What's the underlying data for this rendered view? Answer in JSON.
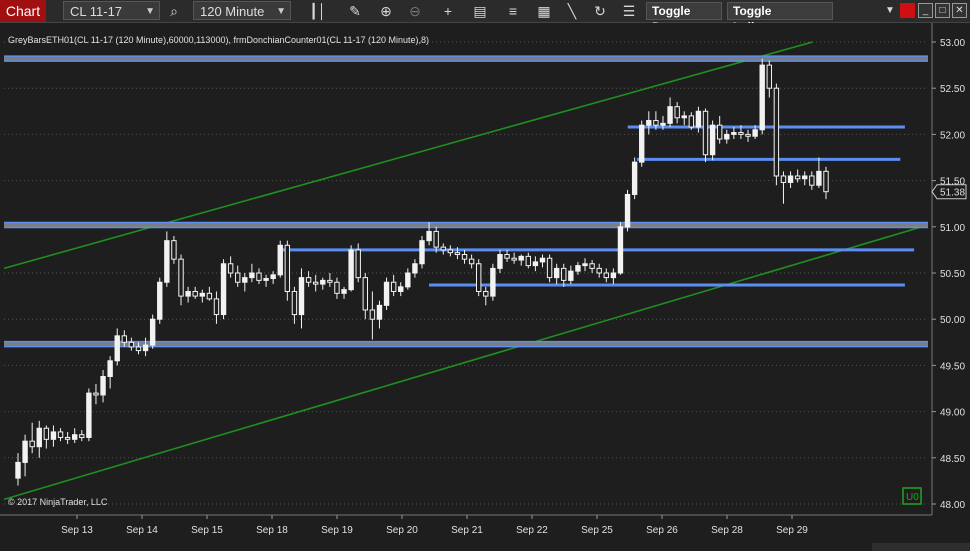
{
  "toolbar": {
    "chart_tab": "Chart",
    "instrument": "CL 11-17",
    "interval": "120 Minute",
    "toggle_draw": "Toggle Draw",
    "toggle_indicators": "Toggle Indicators",
    "icons": [
      "bars-style-icon",
      "pencil-icon",
      "zoom-in-icon",
      "zoom-out-icon",
      "crosshair-icon",
      "data-box-icon",
      "properties-icon",
      "strategies-icon",
      "drawing-tools-icon",
      "reload-icon",
      "list-icon"
    ]
  },
  "chart": {
    "header": "GreyBarsETH01(CL 11-17 (120 Minute),60000,113000), frmDonchianCounter01(CL 11-17 (120 Minute),8)",
    "copyright": "© 2017 NinjaTrader, LLC",
    "last_price": "51.38",
    "badge": "U0",
    "colors": {
      "background": "#1e1e1e",
      "candle": "#f2f2f2",
      "level": "#5b8ef0",
      "trend": "#1f8f1f",
      "badge": "#1fa51f"
    }
  },
  "chart_data": {
    "type": "candlestick",
    "ylim": [
      48.0,
      53.0
    ],
    "y_ticks": [
      "53.00",
      "52.50",
      "52.00",
      "51.50",
      "51.00",
      "50.50",
      "50.00",
      "49.50",
      "49.00",
      "48.50",
      "48.00"
    ],
    "x_ticks": [
      "Sep 13",
      "Sep 14",
      "Sep 15",
      "Sep 18",
      "Sep 19",
      "Sep 20",
      "Sep 21",
      "Sep 22",
      "Sep 25",
      "Sep 26",
      "Sep 28",
      "Sep 29"
    ],
    "candles": [
      {
        "o": 48.28,
        "h": 48.55,
        "l": 48.2,
        "c": 48.45
      },
      {
        "o": 48.45,
        "h": 48.75,
        "l": 48.3,
        "c": 48.68
      },
      {
        "o": 48.68,
        "h": 48.88,
        "l": 48.55,
        "c": 48.62
      },
      {
        "o": 48.62,
        "h": 48.9,
        "l": 48.5,
        "c": 48.82
      },
      {
        "o": 48.82,
        "h": 48.85,
        "l": 48.6,
        "c": 48.7
      },
      {
        "o": 48.7,
        "h": 48.85,
        "l": 48.62,
        "c": 48.78
      },
      {
        "o": 48.78,
        "h": 48.82,
        "l": 48.68,
        "c": 48.72
      },
      {
        "o": 48.72,
        "h": 48.78,
        "l": 48.65,
        "c": 48.7
      },
      {
        "o": 48.7,
        "h": 48.82,
        "l": 48.66,
        "c": 48.75
      },
      {
        "o": 48.75,
        "h": 48.8,
        "l": 48.68,
        "c": 48.72
      },
      {
        "o": 48.72,
        "h": 49.25,
        "l": 48.68,
        "c": 49.2
      },
      {
        "o": 49.2,
        "h": 49.3,
        "l": 49.08,
        "c": 49.18
      },
      {
        "o": 49.18,
        "h": 49.45,
        "l": 49.1,
        "c": 49.38
      },
      {
        "o": 49.38,
        "h": 49.6,
        "l": 49.25,
        "c": 49.55
      },
      {
        "o": 49.55,
        "h": 49.9,
        "l": 49.5,
        "c": 49.82
      },
      {
        "o": 49.82,
        "h": 49.88,
        "l": 49.7,
        "c": 49.75
      },
      {
        "o": 49.75,
        "h": 49.8,
        "l": 49.66,
        "c": 49.7
      },
      {
        "o": 49.7,
        "h": 49.75,
        "l": 49.62,
        "c": 49.66
      },
      {
        "o": 49.66,
        "h": 49.8,
        "l": 49.6,
        "c": 49.72
      },
      {
        "o": 49.72,
        "h": 50.05,
        "l": 49.68,
        "c": 50.0
      },
      {
        "o": 50.0,
        "h": 50.45,
        "l": 49.95,
        "c": 50.4
      },
      {
        "o": 50.4,
        "h": 50.95,
        "l": 50.35,
        "c": 50.85
      },
      {
        "o": 50.85,
        "h": 50.9,
        "l": 50.6,
        "c": 50.65
      },
      {
        "o": 50.65,
        "h": 50.7,
        "l": 50.15,
        "c": 50.25
      },
      {
        "o": 50.25,
        "h": 50.35,
        "l": 50.18,
        "c": 50.3
      },
      {
        "o": 50.3,
        "h": 50.35,
        "l": 50.22,
        "c": 50.25
      },
      {
        "o": 50.25,
        "h": 50.32,
        "l": 50.18,
        "c": 50.28
      },
      {
        "o": 50.28,
        "h": 50.35,
        "l": 50.2,
        "c": 50.22
      },
      {
        "o": 50.22,
        "h": 50.3,
        "l": 49.95,
        "c": 50.05
      },
      {
        "o": 50.05,
        "h": 50.65,
        "l": 50.0,
        "c": 50.6
      },
      {
        "o": 50.6,
        "h": 50.68,
        "l": 50.45,
        "c": 50.5
      },
      {
        "o": 50.5,
        "h": 50.58,
        "l": 50.35,
        "c": 50.4
      },
      {
        "o": 50.4,
        "h": 50.5,
        "l": 50.3,
        "c": 50.45
      },
      {
        "o": 50.45,
        "h": 50.6,
        "l": 50.4,
        "c": 50.5
      },
      {
        "o": 50.5,
        "h": 50.55,
        "l": 50.38,
        "c": 50.42
      },
      {
        "o": 50.42,
        "h": 50.48,
        "l": 50.35,
        "c": 50.44
      },
      {
        "o": 50.44,
        "h": 50.52,
        "l": 50.38,
        "c": 50.48
      },
      {
        "o": 50.48,
        "h": 50.85,
        "l": 50.45,
        "c": 50.8
      },
      {
        "o": 50.8,
        "h": 50.85,
        "l": 50.2,
        "c": 50.3
      },
      {
        "o": 50.3,
        "h": 50.35,
        "l": 49.95,
        "c": 50.05
      },
      {
        "o": 50.05,
        "h": 50.55,
        "l": 49.9,
        "c": 50.45
      },
      {
        "o": 50.45,
        "h": 50.52,
        "l": 50.35,
        "c": 50.4
      },
      {
        "o": 50.4,
        "h": 50.48,
        "l": 50.3,
        "c": 50.38
      },
      {
        "o": 50.38,
        "h": 50.45,
        "l": 50.32,
        "c": 50.42
      },
      {
        "o": 50.42,
        "h": 50.5,
        "l": 50.35,
        "c": 50.4
      },
      {
        "o": 50.4,
        "h": 50.45,
        "l": 50.22,
        "c": 50.28
      },
      {
        "o": 50.28,
        "h": 50.35,
        "l": 50.22,
        "c": 50.32
      },
      {
        "o": 50.32,
        "h": 50.8,
        "l": 50.3,
        "c": 50.75
      },
      {
        "o": 50.75,
        "h": 50.82,
        "l": 50.4,
        "c": 50.45
      },
      {
        "o": 50.45,
        "h": 50.5,
        "l": 50.0,
        "c": 50.1
      },
      {
        "o": 50.1,
        "h": 50.3,
        "l": 49.78,
        "c": 50.0
      },
      {
        "o": 50.0,
        "h": 50.2,
        "l": 49.9,
        "c": 50.15
      },
      {
        "o": 50.15,
        "h": 50.45,
        "l": 50.1,
        "c": 50.4
      },
      {
        "o": 50.4,
        "h": 50.48,
        "l": 50.25,
        "c": 50.3
      },
      {
        "o": 50.3,
        "h": 50.4,
        "l": 50.25,
        "c": 50.35
      },
      {
        "o": 50.35,
        "h": 50.55,
        "l": 50.32,
        "c": 50.5
      },
      {
        "o": 50.5,
        "h": 50.65,
        "l": 50.45,
        "c": 50.6
      },
      {
        "o": 50.6,
        "h": 50.9,
        "l": 50.55,
        "c": 50.85
      },
      {
        "o": 50.85,
        "h": 51.05,
        "l": 50.8,
        "c": 50.95
      },
      {
        "o": 50.95,
        "h": 51.0,
        "l": 50.72,
        "c": 50.78
      },
      {
        "o": 50.78,
        "h": 50.82,
        "l": 50.7,
        "c": 50.75
      },
      {
        "o": 50.75,
        "h": 50.8,
        "l": 50.68,
        "c": 50.72
      },
      {
        "o": 50.72,
        "h": 50.78,
        "l": 50.65,
        "c": 50.7
      },
      {
        "o": 50.7,
        "h": 50.75,
        "l": 50.6,
        "c": 50.65
      },
      {
        "o": 50.65,
        "h": 50.7,
        "l": 50.55,
        "c": 50.6
      },
      {
        "o": 50.6,
        "h": 50.65,
        "l": 50.25,
        "c": 50.3
      },
      {
        "o": 50.3,
        "h": 50.35,
        "l": 50.15,
        "c": 50.25
      },
      {
        "o": 50.25,
        "h": 50.6,
        "l": 50.2,
        "c": 50.55
      },
      {
        "o": 50.55,
        "h": 50.75,
        "l": 50.5,
        "c": 50.7
      },
      {
        "o": 50.7,
        "h": 50.75,
        "l": 50.62,
        "c": 50.66
      },
      {
        "o": 50.66,
        "h": 50.72,
        "l": 50.6,
        "c": 50.64
      },
      {
        "o": 50.64,
        "h": 50.7,
        "l": 50.58,
        "c": 50.68
      },
      {
        "o": 50.68,
        "h": 50.72,
        "l": 50.55,
        "c": 50.58
      },
      {
        "o": 50.58,
        "h": 50.68,
        "l": 50.52,
        "c": 50.62
      },
      {
        "o": 50.62,
        "h": 50.7,
        "l": 50.56,
        "c": 50.66
      },
      {
        "o": 50.66,
        "h": 50.7,
        "l": 50.4,
        "c": 50.45
      },
      {
        "o": 50.45,
        "h": 50.6,
        "l": 50.38,
        "c": 50.55
      },
      {
        "o": 50.55,
        "h": 50.6,
        "l": 50.35,
        "c": 50.42
      },
      {
        "o": 50.42,
        "h": 50.58,
        "l": 50.38,
        "c": 50.52
      },
      {
        "o": 50.52,
        "h": 50.62,
        "l": 50.48,
        "c": 50.58
      },
      {
        "o": 50.58,
        "h": 50.66,
        "l": 50.52,
        "c": 50.6
      },
      {
        "o": 50.6,
        "h": 50.64,
        "l": 50.5,
        "c": 50.55
      },
      {
        "o": 50.55,
        "h": 50.6,
        "l": 50.45,
        "c": 50.5
      },
      {
        "o": 50.5,
        "h": 50.55,
        "l": 50.4,
        "c": 50.45
      },
      {
        "o": 50.45,
        "h": 50.55,
        "l": 50.38,
        "c": 50.5
      },
      {
        "o": 50.5,
        "h": 51.05,
        "l": 50.48,
        "c": 51.0
      },
      {
        "o": 51.0,
        "h": 51.4,
        "l": 50.95,
        "c": 51.35
      },
      {
        "o": 51.35,
        "h": 51.75,
        "l": 51.3,
        "c": 51.7
      },
      {
        "o": 51.7,
        "h": 52.15,
        "l": 51.65,
        "c": 52.1
      },
      {
        "o": 52.1,
        "h": 52.25,
        "l": 52.0,
        "c": 52.15
      },
      {
        "o": 52.15,
        "h": 52.25,
        "l": 52.05,
        "c": 52.1
      },
      {
        "o": 52.1,
        "h": 52.2,
        "l": 52.05,
        "c": 52.12
      },
      {
        "o": 52.12,
        "h": 52.4,
        "l": 52.08,
        "c": 52.3
      },
      {
        "o": 52.3,
        "h": 52.35,
        "l": 52.12,
        "c": 52.18
      },
      {
        "o": 52.18,
        "h": 52.25,
        "l": 52.1,
        "c": 52.2
      },
      {
        "o": 52.2,
        "h": 52.24,
        "l": 52.05,
        "c": 52.08
      },
      {
        "o": 52.08,
        "h": 52.3,
        "l": 52.02,
        "c": 52.25
      },
      {
        "o": 52.25,
        "h": 52.28,
        "l": 51.7,
        "c": 51.78
      },
      {
        "o": 51.78,
        "h": 52.15,
        "l": 51.72,
        "c": 52.1
      },
      {
        "o": 52.1,
        "h": 52.2,
        "l": 51.9,
        "c": 51.95
      },
      {
        "o": 51.95,
        "h": 52.05,
        "l": 51.9,
        "c": 52.0
      },
      {
        "o": 52.0,
        "h": 52.08,
        "l": 51.95,
        "c": 52.02
      },
      {
        "o": 52.02,
        "h": 52.1,
        "l": 51.95,
        "c": 52.0
      },
      {
        "o": 52.0,
        "h": 52.05,
        "l": 51.92,
        "c": 51.98
      },
      {
        "o": 51.98,
        "h": 52.1,
        "l": 51.95,
        "c": 52.05
      },
      {
        "o": 52.05,
        "h": 52.82,
        "l": 52.0,
        "c": 52.75
      },
      {
        "o": 52.75,
        "h": 52.8,
        "l": 52.4,
        "c": 52.5
      },
      {
        "o": 52.5,
        "h": 52.55,
        "l": 51.45,
        "c": 51.55
      },
      {
        "o": 51.55,
        "h": 51.6,
        "l": 51.25,
        "c": 51.48
      },
      {
        "o": 51.48,
        "h": 51.6,
        "l": 51.42,
        "c": 51.55
      },
      {
        "o": 51.55,
        "h": 51.62,
        "l": 51.48,
        "c": 51.52
      },
      {
        "o": 51.52,
        "h": 51.6,
        "l": 51.45,
        "c": 51.55
      },
      {
        "o": 51.55,
        "h": 51.6,
        "l": 51.4,
        "c": 51.45
      },
      {
        "o": 51.45,
        "h": 51.75,
        "l": 51.42,
        "c": 51.6
      },
      {
        "o": 51.6,
        "h": 51.65,
        "l": 51.3,
        "c": 51.38
      }
    ],
    "levels": [
      {
        "y": 52.82,
        "x0": 0,
        "x1": 1
      },
      {
        "y": 51.02,
        "x0": 0,
        "x1": 1
      },
      {
        "y": 49.73,
        "x0": 0,
        "x1": 1
      },
      {
        "y": 52.08,
        "x0": 0.675,
        "x1": 0.975
      },
      {
        "y": 51.73,
        "x0": 0.685,
        "x1": 0.97
      },
      {
        "y": 50.75,
        "x0": 0.3,
        "x1": 0.985
      },
      {
        "y": 50.37,
        "x0": 0.46,
        "x1": 0.975
      }
    ],
    "trendlines": [
      {
        "from": [
          0,
          50.55
        ],
        "to": [
          0.875,
          53.0
        ]
      },
      {
        "from": [
          0,
          48.05
        ],
        "to": [
          1,
          51.02
        ]
      }
    ]
  }
}
